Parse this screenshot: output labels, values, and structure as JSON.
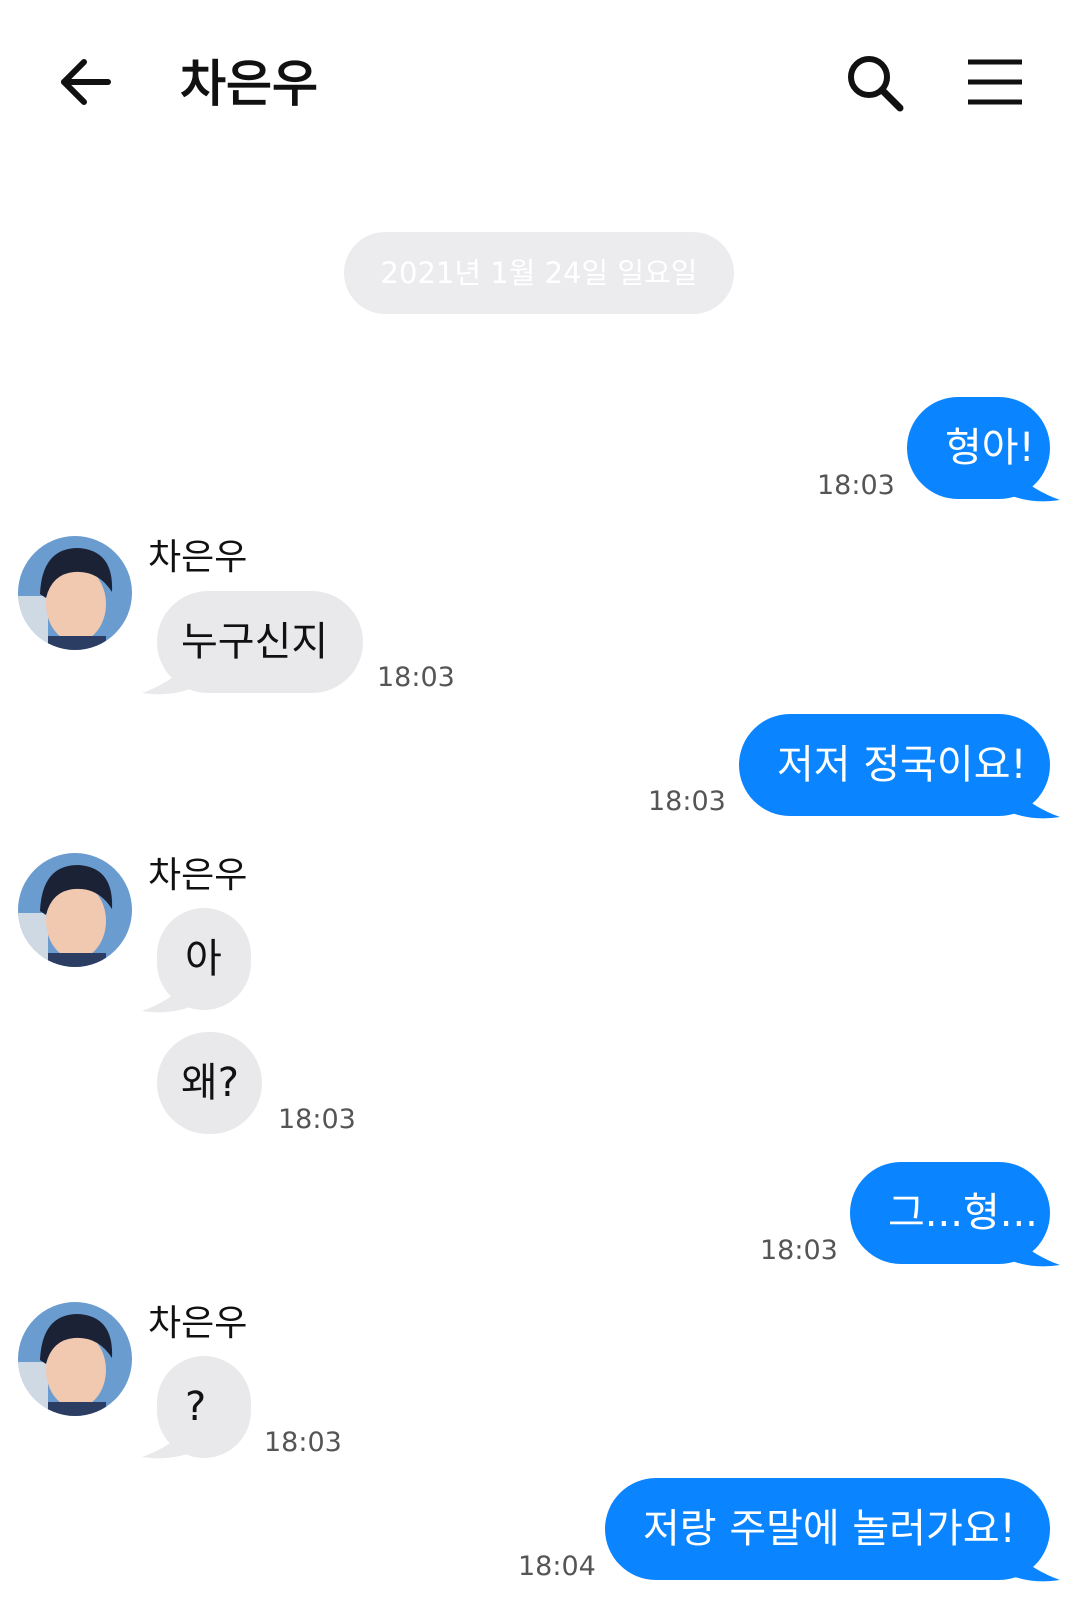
{
  "header": {
    "title": "차은우",
    "back_icon": "arrow-left-icon",
    "search_icon": "search-icon",
    "menu_icon": "menu-icon"
  },
  "date_divider": "2021년 1월 24일 일요일",
  "colors": {
    "outgoing_bubble": "#0a84ff",
    "incoming_bubble": "#e9e9eb",
    "date_pill": "#ececef"
  },
  "messages": [
    {
      "direction": "out",
      "text": "형아!",
      "time": "18:03"
    },
    {
      "direction": "in",
      "sender": "차은우",
      "text": "누구신지",
      "time": "18:03"
    },
    {
      "direction": "out",
      "text": "저저 정국이요!",
      "time": "18:03"
    },
    {
      "direction": "in",
      "sender": "차은우",
      "text": "아",
      "time": ""
    },
    {
      "direction": "in",
      "text": "왜?",
      "time": "18:03"
    },
    {
      "direction": "out",
      "text": "그...형...",
      "time": "18:03"
    },
    {
      "direction": "in",
      "sender": "차은우",
      "text": "?",
      "time": "18:03"
    },
    {
      "direction": "out",
      "text": "저랑 주말에 놀러가요!",
      "time": "18:04"
    }
  ]
}
